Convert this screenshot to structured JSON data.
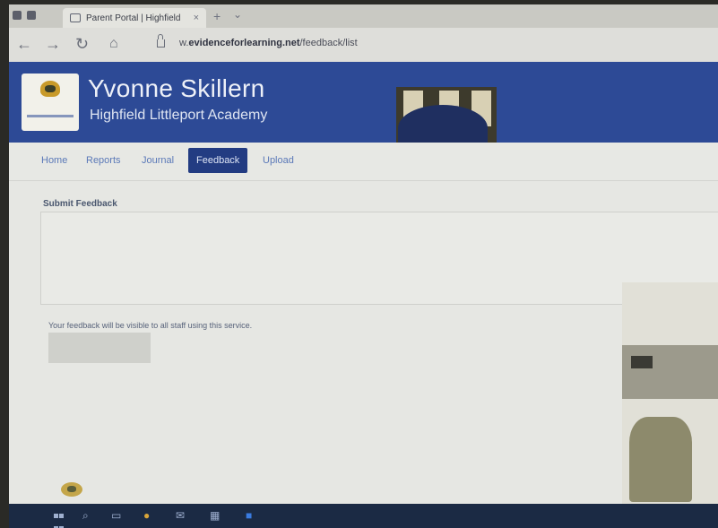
{
  "browser": {
    "tab_title": "Parent Portal | Highfield",
    "tab_close": "×",
    "new_tab": "+",
    "url_prefix": "w.",
    "url_domain": "evidenceforlearning.net",
    "url_path": "/feedback/list"
  },
  "header": {
    "student_name": "Yvonne Skillern",
    "school_name": "Highfield Littleport Academy",
    "brand_color": "#2d4a96"
  },
  "nav": {
    "items": [
      "Home",
      "Reports",
      "Journal",
      "Feedback",
      "Upload"
    ],
    "active": "Feedback"
  },
  "feedback": {
    "section_title": "Submit Feedback",
    "textarea_value": "",
    "note": "Your feedback will be visible to all staff using this service.",
    "submit_label": ""
  },
  "taskbar": {
    "icons": [
      "windows-icon",
      "search-icon",
      "task-view-icon",
      "chrome-icon",
      "mail-icon",
      "store-icon",
      "edge-icon"
    ]
  }
}
